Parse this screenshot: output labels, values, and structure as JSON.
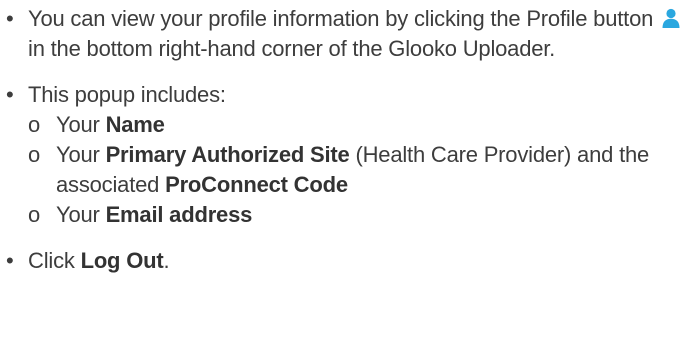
{
  "bullets": {
    "profile": {
      "before_icon": "You can view your profile information by clicking the Profile button",
      "icon": "person-icon",
      "after_icon": "in the bottom right-hand corner of the Glooko Uploader."
    },
    "popup": {
      "intro": "This popup includes:",
      "items": [
        {
          "prefix": "Your ",
          "bold": "Name",
          "suffix": ""
        },
        {
          "prefix": "Your ",
          "bold": "Primary Authorized Site",
          "suffix": " (Health Care Provider) and the associated ",
          "bold2": "ProConnect Code"
        },
        {
          "prefix": "Your ",
          "bold": "Email address",
          "suffix": ""
        }
      ]
    },
    "logout": {
      "prefix": "Click ",
      "bold": "Log Out",
      "suffix": "."
    }
  },
  "colors": {
    "text": "#3d3d3d",
    "icon": "#2aa7df"
  },
  "markers": {
    "bullet": "•",
    "sub": "o"
  }
}
